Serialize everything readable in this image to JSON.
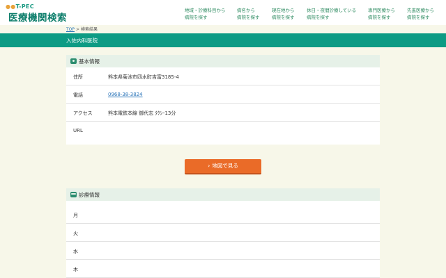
{
  "header": {
    "logo_sub": "T-PEC",
    "logo_title": "医療機関検索",
    "nav": [
      {
        "line1": "地域・診療科目から",
        "line2": "病院を探す"
      },
      {
        "line1": "病名から",
        "line2": "病院を探す"
      },
      {
        "line1": "現在地から",
        "line2": "病院を探す"
      },
      {
        "line1": "休日・夜間診療している",
        "line2": "病院を探す"
      },
      {
        "line1": "専門医療から",
        "line2": "病院を探す"
      },
      {
        "line1": "先進医療から",
        "line2": "病院を探す"
      }
    ]
  },
  "breadcrumb": {
    "top": "TOP",
    "separator": ">",
    "current": "検索結果"
  },
  "page_title": "入佐内科医院",
  "basic_info": {
    "heading": "基本情報",
    "rows": [
      {
        "label": "住所",
        "value": "熊本県菊池市四水町吉富3185-4"
      },
      {
        "label": "電話",
        "value": "0968-38-3824"
      },
      {
        "label": "アクセス",
        "value": "熊本電鉄本線 御代志 ﾀｸｼｰ13分"
      },
      {
        "label": "URL",
        "value": ""
      }
    ]
  },
  "map_button": {
    "label": "地図で見る",
    "chevron": "›"
  },
  "diagnosis_info": {
    "heading": "診療情報",
    "days": [
      "月",
      "火",
      "水",
      "木"
    ]
  },
  "colors": {
    "brand": "#0d9b84",
    "accent": "#ea6b28",
    "link": "#2a74b8"
  }
}
